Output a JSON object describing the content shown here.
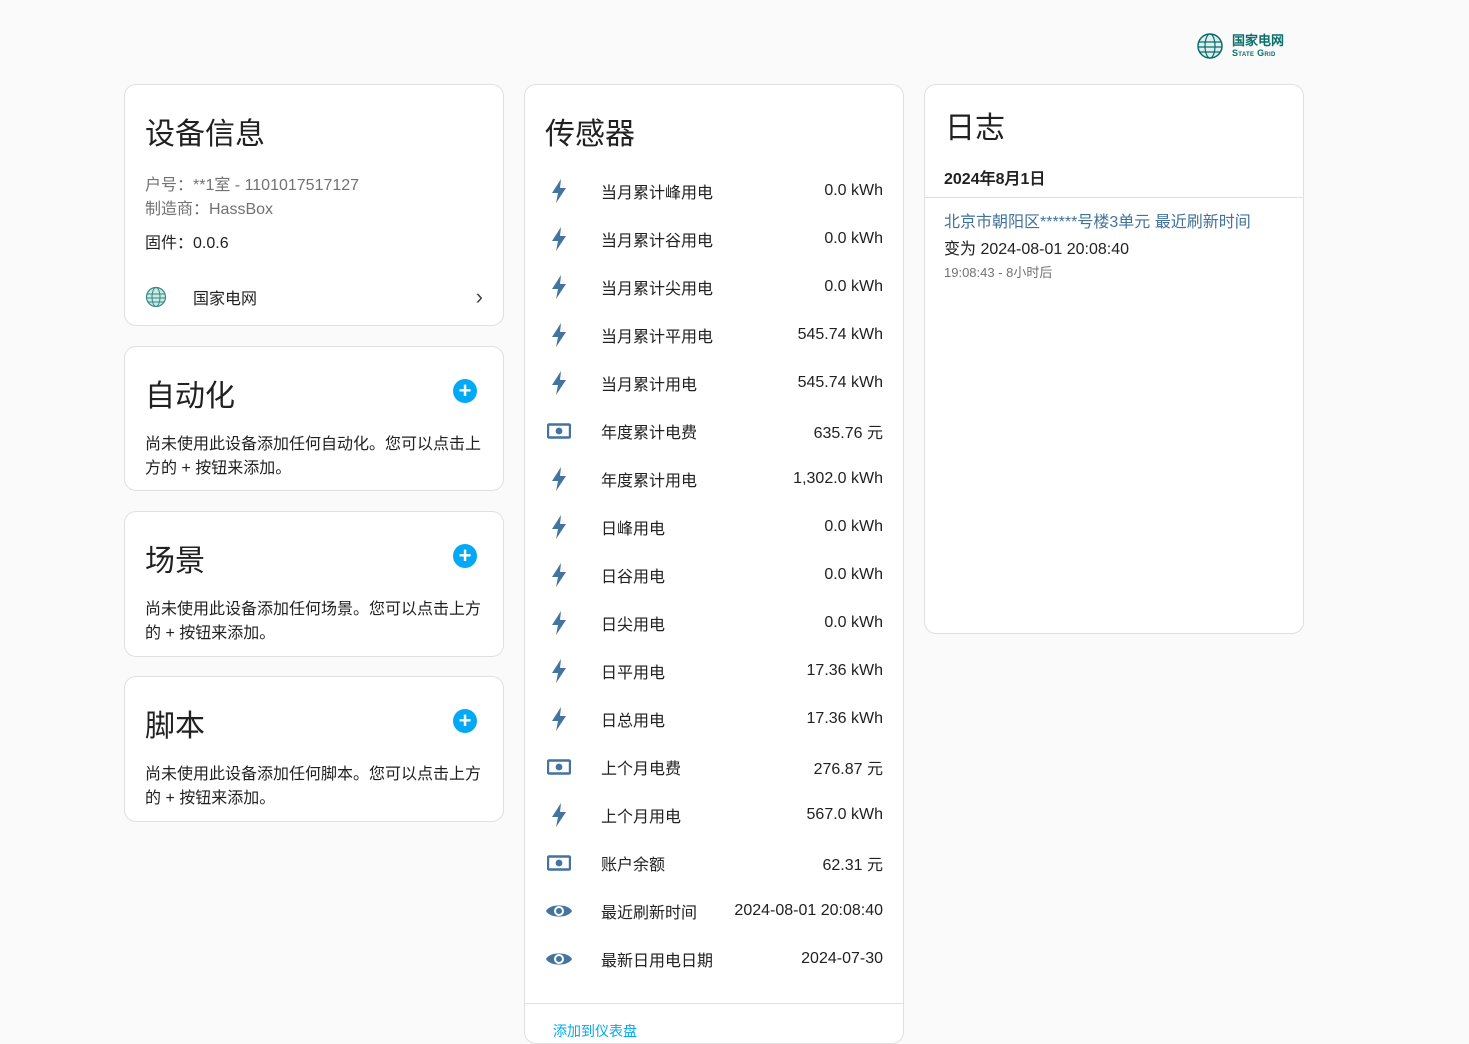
{
  "brand": {
    "cn": "国家电网",
    "en": "State Grid"
  },
  "device": {
    "title": "设备信息",
    "account": "户号：**1室 - 1101017517127",
    "manufacturer": "制造商：HassBox",
    "firmware": "固件：0.0.6",
    "integration_label": "国家电网"
  },
  "automation": {
    "title": "自动化",
    "desc": "尚未使用此设备添加任何自动化。您可以点击上方的 + 按钮来添加。"
  },
  "scene": {
    "title": "场景",
    "desc": "尚未使用此设备添加任何场景。您可以点击上方的 + 按钮来添加。"
  },
  "script": {
    "title": "脚本",
    "desc": "尚未使用此设备添加任何脚本。您可以点击上方的 + 按钮来添加。"
  },
  "sensors": {
    "title": "传感器",
    "add_link": "添加到仪表盘",
    "items": [
      {
        "icon": "flash",
        "name": "当月累计峰用电",
        "value": "0.0 kWh"
      },
      {
        "icon": "flash",
        "name": "当月累计谷用电",
        "value": "0.0 kWh"
      },
      {
        "icon": "flash",
        "name": "当月累计尖用电",
        "value": "0.0 kWh"
      },
      {
        "icon": "flash",
        "name": "当月累计平用电",
        "value": "545.74 kWh"
      },
      {
        "icon": "flash",
        "name": "当月累计用电",
        "value": "545.74 kWh"
      },
      {
        "icon": "cash",
        "name": "年度累计电费",
        "value": "635.76 元"
      },
      {
        "icon": "flash",
        "name": "年度累计用电",
        "value": "1,302.0 kWh"
      },
      {
        "icon": "flash",
        "name": "日峰用电",
        "value": "0.0 kWh"
      },
      {
        "icon": "flash",
        "name": "日谷用电",
        "value": "0.0 kWh"
      },
      {
        "icon": "flash",
        "name": "日尖用电",
        "value": "0.0 kWh"
      },
      {
        "icon": "flash",
        "name": "日平用电",
        "value": "17.36 kWh"
      },
      {
        "icon": "flash",
        "name": "日总用电",
        "value": "17.36 kWh"
      },
      {
        "icon": "cash",
        "name": "上个月电费",
        "value": "276.87 元"
      },
      {
        "icon": "flash",
        "name": "上个月用电",
        "value": "567.0 kWh"
      },
      {
        "icon": "cash",
        "name": "账户余额",
        "value": "62.31 元"
      },
      {
        "icon": "eye",
        "name": "最近刷新时间",
        "value": "2024-08-01 20:08:40"
      },
      {
        "icon": "eye",
        "name": "最新日用电日期",
        "value": "2024-07-30"
      }
    ]
  },
  "logbook": {
    "title": "日志",
    "date": "2024年8月1日",
    "entry_link": "北京市朝阳区******号楼3单元 最近刷新时间",
    "entry_msg": "变为 2024-08-01 20:08:40",
    "entry_time": "19:08:43 - 8小时后"
  },
  "colors": {
    "accent": "#03a9f4",
    "icon": "#44739e",
    "link": "#42729b"
  }
}
